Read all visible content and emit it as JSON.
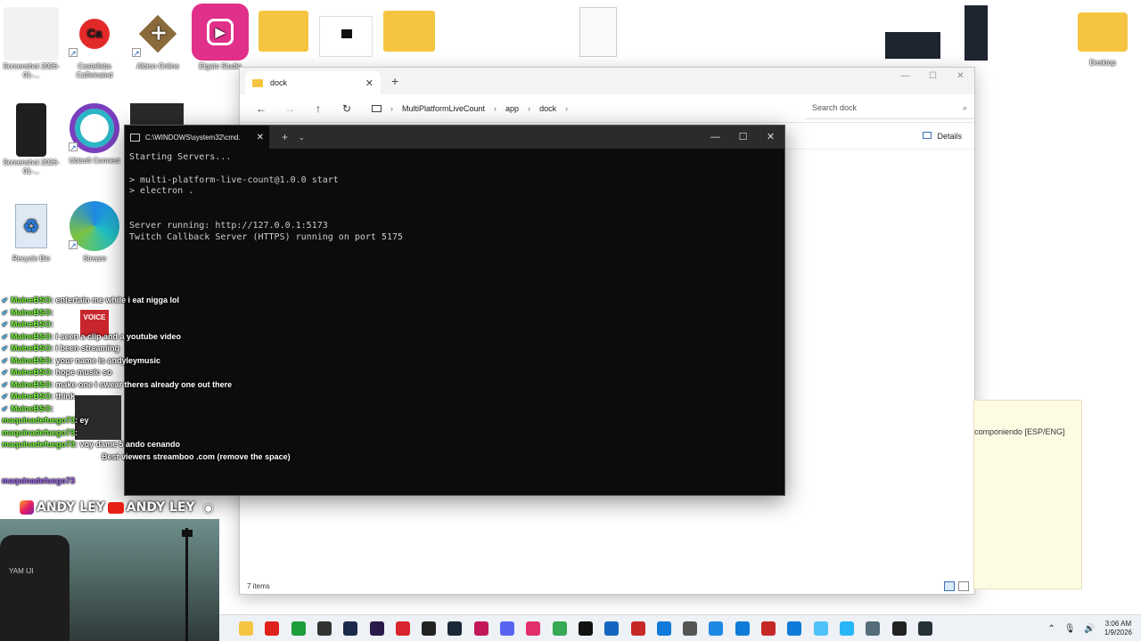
{
  "desktop": {
    "icons": [
      {
        "label": "Screenshot 2026-01-...",
        "icon": "screenshot-icon",
        "color": "#f4f4f4"
      },
      {
        "label": "Castellabs Caffeinated",
        "icon": "caffeinated-icon",
        "color": "#ffffff"
      },
      {
        "label": "Albion Online",
        "icon": "albion-icon",
        "color": "#ffffff"
      },
      {
        "label": "Elgato Studio",
        "icon": "elgato-icon",
        "color": "#e0308a"
      },
      {
        "label": "Screenshot 2026-01-...",
        "icon": "screenshot-icon",
        "color": "#1e1e1e"
      },
      {
        "label": "Ubisoft Connect",
        "icon": "ubisoft-icon",
        "color": "#ffffff"
      },
      {
        "label": "Recycle Bin",
        "icon": "recycle-bin-icon",
        "color": "#e6f0fa"
      },
      {
        "label": "Stream",
        "icon": "edge-icon",
        "color": "#1e88e5"
      },
      {
        "label": "Desktop",
        "icon": "folder-icon",
        "color": "#f5c542"
      }
    ]
  },
  "explorer": {
    "tab_title": "dock",
    "breadcrumb": [
      "MultiPlatformLiveCount",
      "app",
      "dock"
    ],
    "search_placeholder": "Search dock",
    "details_label": "Details",
    "status_text": "7 items"
  },
  "note": {
    "text": "componiendo [ESP/ENG]"
  },
  "cmd": {
    "tab_title": "C:\\WINDOWS\\system32\\cmd.",
    "output": "Starting Servers...\n\n> multi-platform-live-count@1.0.0 start\n> electron .\n\n\nServer running: http://127.0.0.1:5173\nTwitch Callback Server (HTTPS) running on port 5175"
  },
  "chat": [
    {
      "user": "MaineBSO",
      "msg": "entertain me while i eat nigga lol",
      "color": "green"
    },
    {
      "user": "MaineBSO",
      "msg": "",
      "color": "green"
    },
    {
      "user": "MaineBSO",
      "msg": "",
      "color": "green"
    },
    {
      "user": "MaineBSO",
      "msg": "i seen a clip and a youtube video",
      "color": "green"
    },
    {
      "user": "MaineBSO",
      "msg": "i been streaming",
      "color": "green"
    },
    {
      "user": "MaineBSO",
      "msg": "your name is andyleymusic",
      "color": "green"
    },
    {
      "user": "MaineBSO",
      "msg": "hope music so",
      "color": "green"
    },
    {
      "user": "MaineBSO",
      "msg": "make one i swear theres already one out there",
      "color": "green"
    },
    {
      "user": "MaineBSO",
      "msg": "think",
      "color": "green"
    },
    {
      "user": "MaineBSO",
      "msg": "",
      "color": "green"
    },
    {
      "user": "maquinadefuego73",
      "msg": "ey",
      "color": "green"
    },
    {
      "user": "maquinadefuego73",
      "msg": "",
      "color": "green"
    },
    {
      "user": "maquinadefuego73",
      "msg": "voy dame 5 ando cenando",
      "color": "green"
    },
    {
      "user": "",
      "msg": "Best viewers streamboo .com (remove the space)",
      "color": "purple"
    },
    {
      "user": "",
      "msg": "",
      "color": "purple"
    },
    {
      "user": "maquinadefuego73",
      "msg": "",
      "color": "purple"
    }
  ],
  "banner": {
    "text1": "ANDY LEY",
    "text2": "ANDY LEY"
  },
  "webcam": {
    "chair_text": "YAM IJI"
  },
  "taskbar": {
    "icons": [
      {
        "name": "file-explorer-icon",
        "color": "#f5c542"
      },
      {
        "name": "opera-icon",
        "color": "#e0221c"
      },
      {
        "name": "xbox-icon",
        "color": "#1c9e3a"
      },
      {
        "name": "overwolf-icon",
        "color": "#333333"
      },
      {
        "name": "photoshop-icon",
        "color": "#1b2a4a"
      },
      {
        "name": "premiere-icon",
        "color": "#2a1a4a"
      },
      {
        "name": "media-icon",
        "color": "#d8252e"
      },
      {
        "name": "epic-games-icon",
        "color": "#222222"
      },
      {
        "name": "steam-icon",
        "color": "#1b2838"
      },
      {
        "name": "app-icon",
        "color": "#c2185b"
      },
      {
        "name": "discord-icon",
        "color": "#5865f2"
      },
      {
        "name": "instagram-icon",
        "color": "#e1306c"
      },
      {
        "name": "chrome-icon",
        "color": "#34a853"
      },
      {
        "name": "tiktok-icon",
        "color": "#111111"
      },
      {
        "name": "app-icon",
        "color": "#1565c0"
      },
      {
        "name": "caffeinated-icon",
        "color": "#c62828"
      },
      {
        "name": "edge-icon",
        "color": "#0f7ad8"
      },
      {
        "name": "pen-icon",
        "color": "#555555"
      },
      {
        "name": "photos-icon",
        "color": "#1e88e5"
      },
      {
        "name": "edge-icon",
        "color": "#0f7ad8"
      },
      {
        "name": "caffeinated-icon",
        "color": "#c62828"
      },
      {
        "name": "edge-icon",
        "color": "#0f7ad8"
      },
      {
        "name": "image-icon",
        "color": "#4fc3f7"
      },
      {
        "name": "notepad-icon",
        "color": "#29b6f6"
      },
      {
        "name": "tools-icon",
        "color": "#546e7a"
      },
      {
        "name": "terminal-icon",
        "color": "#222222"
      },
      {
        "name": "app-icon",
        "color": "#263238"
      }
    ],
    "time": "3:06 AM",
    "date": "1/9/2026"
  }
}
